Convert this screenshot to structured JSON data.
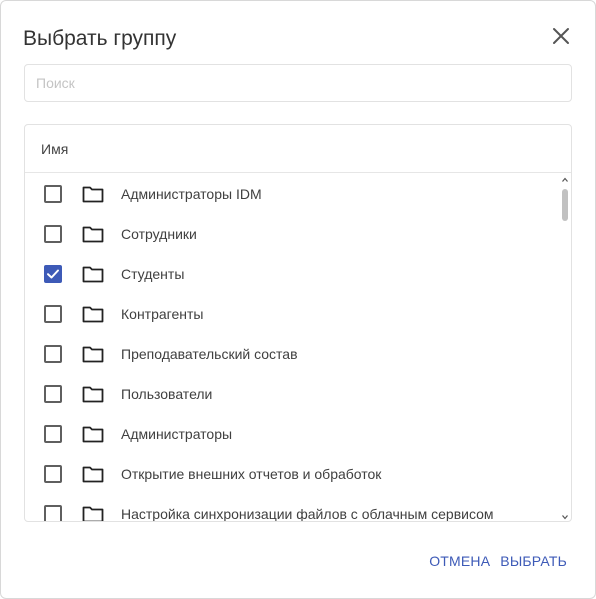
{
  "dialog": {
    "title": "Выбрать группу",
    "close_icon": "close-icon"
  },
  "search": {
    "placeholder": "Поиск",
    "value": ""
  },
  "table": {
    "column_header": "Имя",
    "rows": [
      {
        "label": "Администраторы IDM",
        "checked": false,
        "icon": "folder-icon"
      },
      {
        "label": "Сотрудники",
        "checked": false,
        "icon": "folder-icon"
      },
      {
        "label": "Студенты",
        "checked": true,
        "icon": "folder-icon"
      },
      {
        "label": "Контрагенты",
        "checked": false,
        "icon": "folder-icon"
      },
      {
        "label": "Преподавательский состав",
        "checked": false,
        "icon": "folder-icon"
      },
      {
        "label": "Пользователи",
        "checked": false,
        "icon": "folder-icon"
      },
      {
        "label": "Администраторы",
        "checked": false,
        "icon": "folder-icon"
      },
      {
        "label": "Открытие внешних отчетов и обработок",
        "checked": false,
        "icon": "folder-icon"
      },
      {
        "label": "Настройка синхронизации файлов с облачным сервисом",
        "checked": false,
        "icon": "folder-icon"
      }
    ]
  },
  "actions": {
    "cancel_label": "ОТМЕНА",
    "select_label": "ВЫБРАТЬ"
  },
  "colors": {
    "accent": "#3d5ab7",
    "checkbox_border": "#5f5f5f",
    "text": "#404040"
  }
}
